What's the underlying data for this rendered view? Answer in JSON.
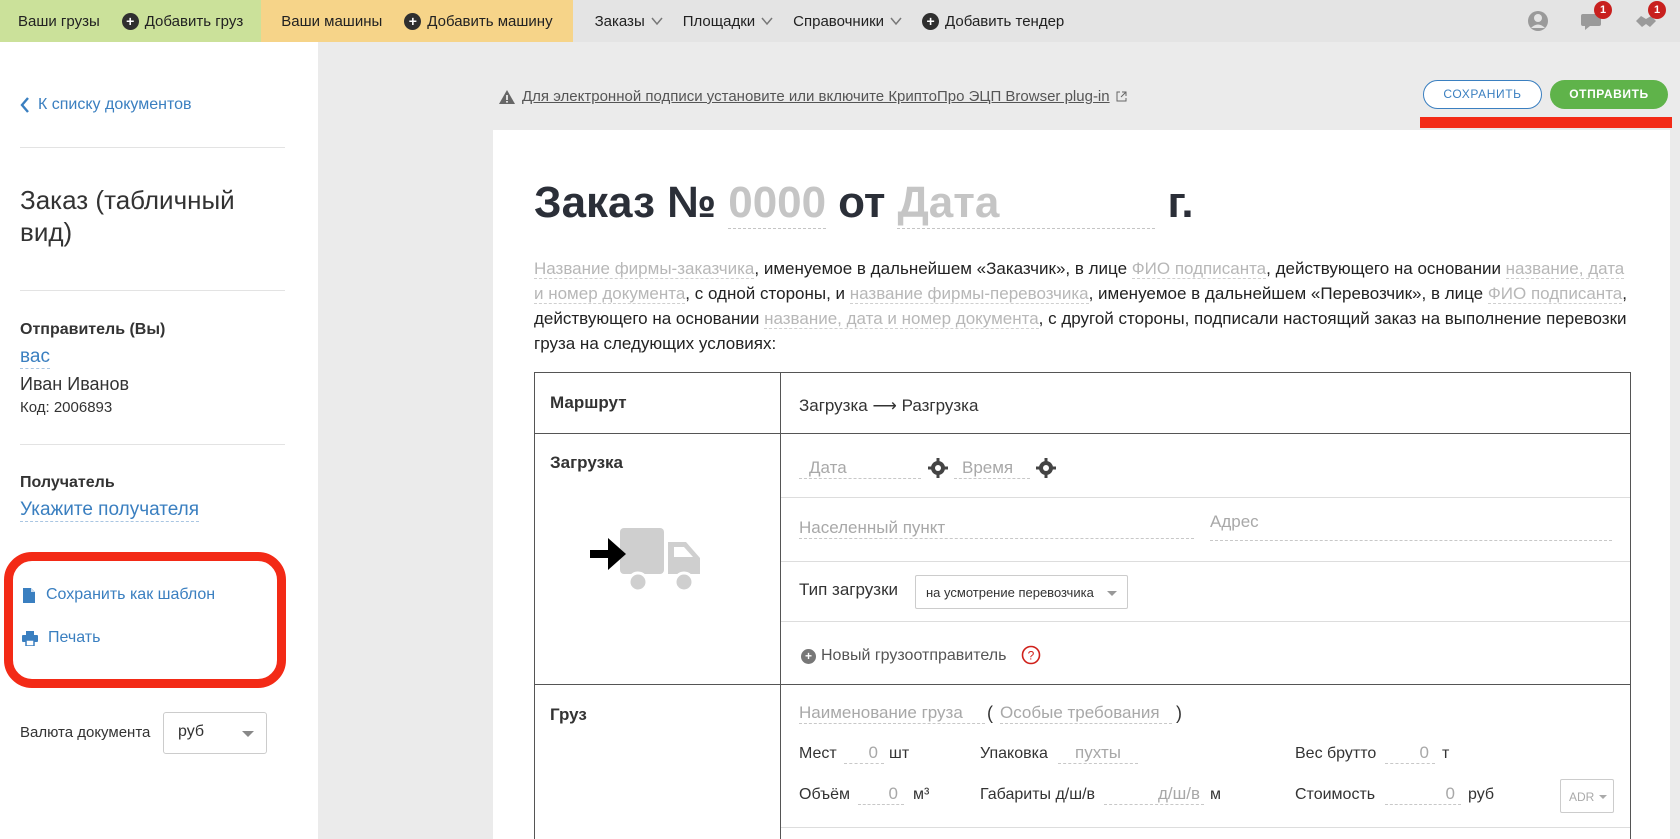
{
  "topbar": {
    "your_cargo": "Ваши грузы",
    "add_cargo": "Добавить груз",
    "your_vehicles": "Ваши машины",
    "add_vehicle": "Добавить машину",
    "orders": "Заказы",
    "sites": "Площадки",
    "directories": "Справочники",
    "add_tender": "Добавить тендер",
    "messages_badge": "1",
    "notifications_badge": "1"
  },
  "sidebar": {
    "back_link": "К списку документов",
    "doc_title": "Заказ (табличный вид)",
    "sender_label": "Отправитель (Вы)",
    "sender_link": "вас",
    "sender_name": "Иван Иванов",
    "sender_code": "Код: 2006893",
    "recipient_label": "Получатель",
    "recipient_link": "Укажите получателя",
    "save_template": "Сохранить как шаблон",
    "print": "Печать",
    "currency_label": "Валюта документа",
    "currency_value": "руб"
  },
  "toolbar": {
    "warning": "Для электронной подписи установите или включите КриптоПро ЭЦП Browser plug-in",
    "save": "СОХРАНИТЬ",
    "send": "ОТПРАВИТЬ"
  },
  "doc": {
    "title_prefix": "Заказ №",
    "number_ph": "0000",
    "from": "от",
    "date_ph": "Дата",
    "year_suffix": "г.",
    "intro": {
      "p1": "Название фирмы-заказчика",
      "t1": ", именуемое в дальнейшем «Заказчик», в лице ",
      "p2": "ФИО подписанта",
      "t2": ", действующего на основании ",
      "p3": "название, дата и номер документа",
      "t3": ", с одной стороны, и ",
      "p4": "название фирмы-перевозчика",
      "t4": ", именуемое в дальнейшем «Перевозчик», в лице ",
      "p5": "ФИО подписанта",
      "t5": ", действующего на основании ",
      "p6": "название, дата и номер документа",
      "t6": ", с другой стороны, подписали настоящий заказ на выполнение перевозки груза на следующих условиях:"
    },
    "route_label": "Маршрут",
    "route_value": "Загрузка ⟶ Разгрузка",
    "loading_label": "Загрузка",
    "date_field": "Дата",
    "time_field": "Время",
    "locality_field": "Населенный пункт",
    "address_field": "Адрес",
    "loading_type_label": "Тип загрузки",
    "loading_type_value": "на усмотрение перевозчика",
    "new_shipper": "Новый грузоотправитель",
    "cargo_label": "Груз",
    "cargo_name_field": "Наименование груза",
    "special_req_field": "Особые требования",
    "places_label": "Мест",
    "places_value": "0",
    "places_unit": "шт",
    "packaging_label": "Упаковка",
    "packaging_value": "пухты",
    "gross_label": "Вес брутто",
    "gross_value": "0",
    "gross_unit": "т",
    "volume_label": "Объём",
    "volume_value": "0",
    "volume_unit": "м³",
    "dims_label": "Габариты д/ш/в",
    "dims_value": "д/ш/в",
    "dims_unit": "м",
    "cost_label": "Стоимость",
    "cost_value": "0",
    "cost_unit": "руб",
    "adr": "ADR"
  }
}
